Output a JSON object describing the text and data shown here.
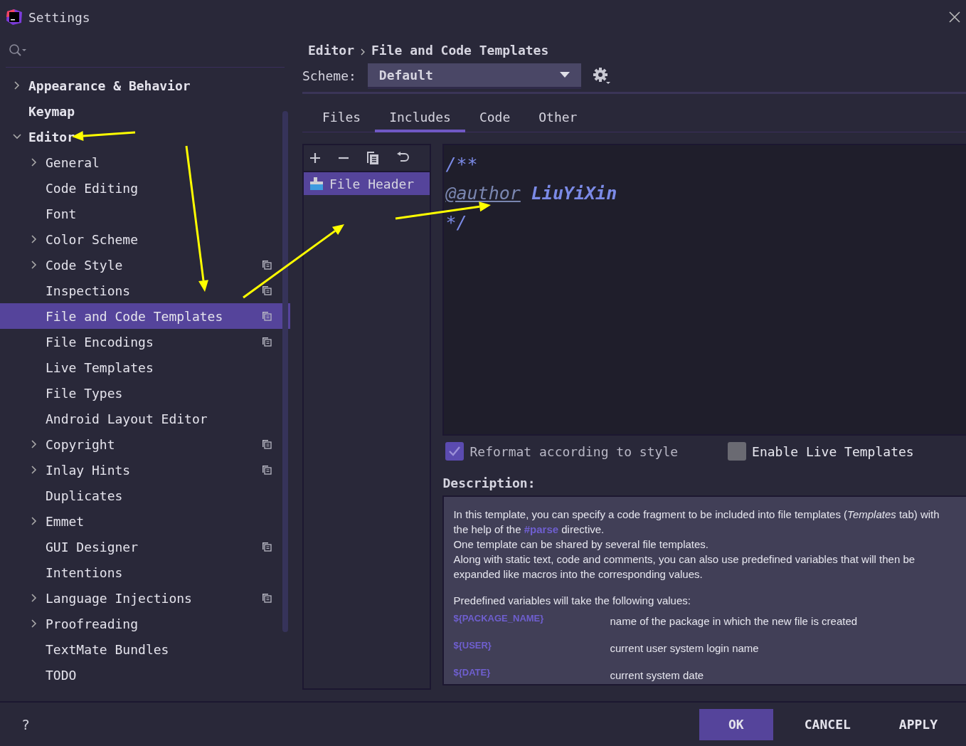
{
  "window": {
    "title": "Settings"
  },
  "sidebar": {
    "items": [
      {
        "label": "Appearance & Behavior",
        "expanded": false,
        "selected": false
      },
      {
        "label": "Keymap",
        "selected": false
      },
      {
        "label": "Editor",
        "expanded": true,
        "selected": false,
        "children": [
          {
            "label": "General",
            "expanded": false,
            "selected": false
          },
          {
            "label": "Code Editing",
            "selected": false
          },
          {
            "label": "Font",
            "selected": false
          },
          {
            "label": "Color Scheme",
            "expanded": false,
            "selected": false
          },
          {
            "label": "Code Style",
            "expanded": false,
            "selected": false,
            "per_project": true
          },
          {
            "label": "Inspections",
            "selected": false,
            "per_project": true
          },
          {
            "label": "File and Code Templates",
            "selected": true,
            "per_project": true
          },
          {
            "label": "File Encodings",
            "selected": false,
            "per_project": true
          },
          {
            "label": "Live Templates",
            "selected": false
          },
          {
            "label": "File Types",
            "selected": false
          },
          {
            "label": "Android Layout Editor",
            "selected": false
          },
          {
            "label": "Copyright",
            "expanded": false,
            "selected": false,
            "per_project": true
          },
          {
            "label": "Inlay Hints",
            "expanded": false,
            "selected": false,
            "per_project": true
          },
          {
            "label": "Duplicates",
            "selected": false
          },
          {
            "label": "Emmet",
            "expanded": false,
            "selected": false
          },
          {
            "label": "GUI Designer",
            "selected": false,
            "per_project": true
          },
          {
            "label": "Intentions",
            "selected": false
          },
          {
            "label": "Language Injections",
            "expanded": false,
            "selected": false,
            "per_project": true
          },
          {
            "label": "Proofreading",
            "expanded": false,
            "selected": false
          },
          {
            "label": "TextMate Bundles",
            "selected": false
          },
          {
            "label": "TODO",
            "selected": false
          }
        ]
      }
    ]
  },
  "breadcrumb": [
    "Editor",
    "File and Code Templates"
  ],
  "scheme": {
    "label": "Scheme:",
    "value": "Default"
  },
  "tabs": [
    {
      "label": "Files",
      "selected": false
    },
    {
      "label": "Includes",
      "selected": true
    },
    {
      "label": "Code",
      "selected": false
    },
    {
      "label": "Other",
      "selected": false
    }
  ],
  "templates": [
    {
      "label": "File Header",
      "selected": true
    }
  ],
  "editor": {
    "lines": [
      {
        "tokens": [
          {
            "text": "/**",
            "kind": "comment"
          }
        ]
      },
      {
        "tokens": [
          {
            "text": "@author",
            "kind": "tag"
          },
          {
            "text": "LiuYiXin",
            "kind": "value"
          }
        ]
      },
      {
        "tokens": [
          {
            "text": "*/",
            "kind": "comment"
          }
        ]
      }
    ]
  },
  "options": [
    {
      "label": "Reformat according to style",
      "checked": true
    },
    {
      "label": "Enable Live Templates",
      "checked": false
    }
  ],
  "description": {
    "label": "Description:",
    "paragraphs": [
      "In this template, you can specify a code fragment to be included into file templates (*Templates* tab) with the help of the **#parse** directive.",
      "One template can be shared by several file templates.",
      "Along with static text, code and comments, you can also use predefined variables that will then be expanded like macros into the corresponding values."
    ],
    "intro": "Predefined variables will take the following values:",
    "variables": [
      {
        "name": "${PACKAGE_NAME}",
        "meaning": "name of the package in which the new file is created"
      },
      {
        "name": "${USER}",
        "meaning": "current user system login name"
      },
      {
        "name": "${DATE}",
        "meaning": "current system date"
      }
    ]
  },
  "footer": {
    "help": "?",
    "buttons": [
      {
        "label": "OK",
        "primary": true
      },
      {
        "label": "CANCEL",
        "primary": false
      },
      {
        "label": "APPLY",
        "primary": false
      }
    ]
  },
  "annotations": [
    {
      "kind": "arrow"
    },
    {
      "kind": "arrow"
    },
    {
      "kind": "arrow"
    },
    {
      "kind": "arrow"
    }
  ]
}
